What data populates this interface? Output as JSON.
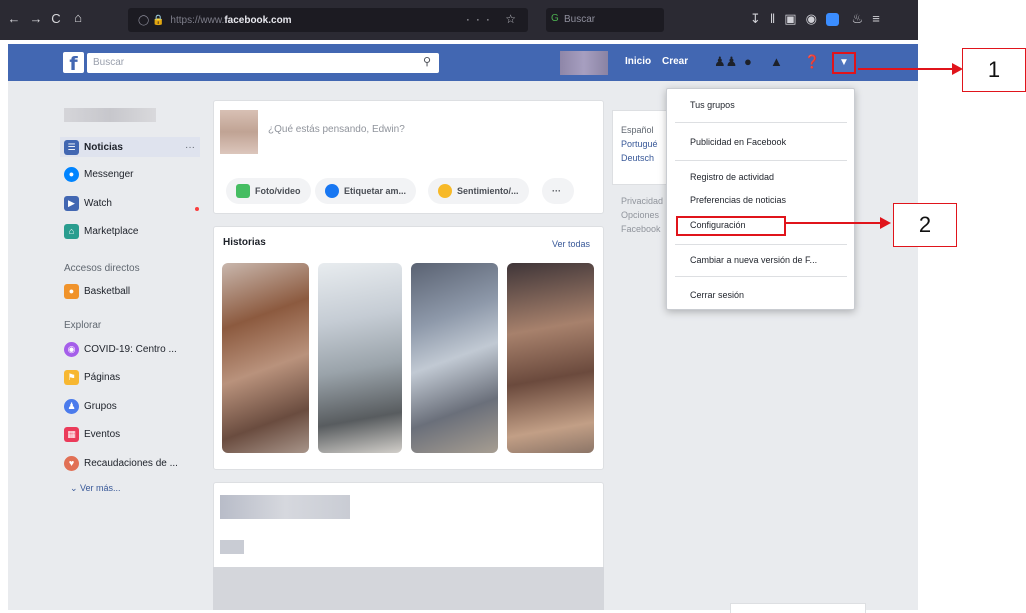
{
  "browser": {
    "url_prefix": "https://www.",
    "url_domain": "facebook.com",
    "search_placeholder": "Buscar",
    "nav_back": "←",
    "nav_forward": "→",
    "reload": "C",
    "home": "⌂",
    "menu_dots": "···",
    "g_badge": "G"
  },
  "fb_header": {
    "logo": "f",
    "search_placeholder": "Buscar",
    "nav": [
      "Inicio",
      "Crear"
    ],
    "menu_caret": "▼",
    "icons": [
      "friends-icon",
      "messenger-icon",
      "bell-icon",
      "help-icon",
      "caret-icon"
    ]
  },
  "sidebar": {
    "items": [
      {
        "label": "Noticias",
        "icon": "news-feed-icon",
        "color": "#4267b2"
      },
      {
        "label": "Messenger",
        "icon": "messenger-icon",
        "color": "#0084ff"
      },
      {
        "label": "Watch",
        "icon": "watch-icon",
        "color": "#4267b2"
      },
      {
        "label": "Marketplace",
        "icon": "marketplace-icon",
        "color": "#2a9d8f"
      }
    ],
    "shortcuts_title": "Accesos directos",
    "shortcuts": [
      {
        "label": "Basketball",
        "icon": "basketball-icon",
        "color": "#f0932b"
      }
    ],
    "explore_title": "Explorar",
    "explore": [
      {
        "label": "COVID-19: Centro ...",
        "icon": "covid-icon",
        "color": "#a55eea"
      },
      {
        "label": "Páginas",
        "icon": "pages-icon",
        "color": "#f7b731"
      },
      {
        "label": "Grupos",
        "icon": "groups-icon",
        "color": "#4b7bec"
      },
      {
        "label": "Eventos",
        "icon": "events-icon",
        "color": "#eb3b5a"
      },
      {
        "label": "Recaudaciones de ...",
        "icon": "fundraisers-icon",
        "color": "#e17055"
      }
    ],
    "see_more": "⌄  Ver más...",
    "item_dots": "···"
  },
  "composer": {
    "placeholder": "¿Qué estás pensando, Edwin?",
    "actions": [
      "Foto/video",
      "Etiquetar am...",
      "Sentimiento/...",
      "···"
    ]
  },
  "stories": {
    "title": "Historias",
    "see_all": "Ver todas"
  },
  "right_column": {
    "current_language": "Español",
    "languages": [
      "Portugué",
      "Deutsch"
    ],
    "footer": [
      "Privacidad",
      "Opciones",
      "Facebook"
    ]
  },
  "dropdown": {
    "items": [
      "Tus grupos",
      "Publicidad en Facebook",
      "Registro de actividad",
      "Preferencias de noticias",
      "Configuración",
      "Cambiar a nueva versión de F...",
      "Cerrar sesión"
    ]
  },
  "annotations": {
    "one": "1",
    "two": "2",
    "color": "#e0141b"
  }
}
